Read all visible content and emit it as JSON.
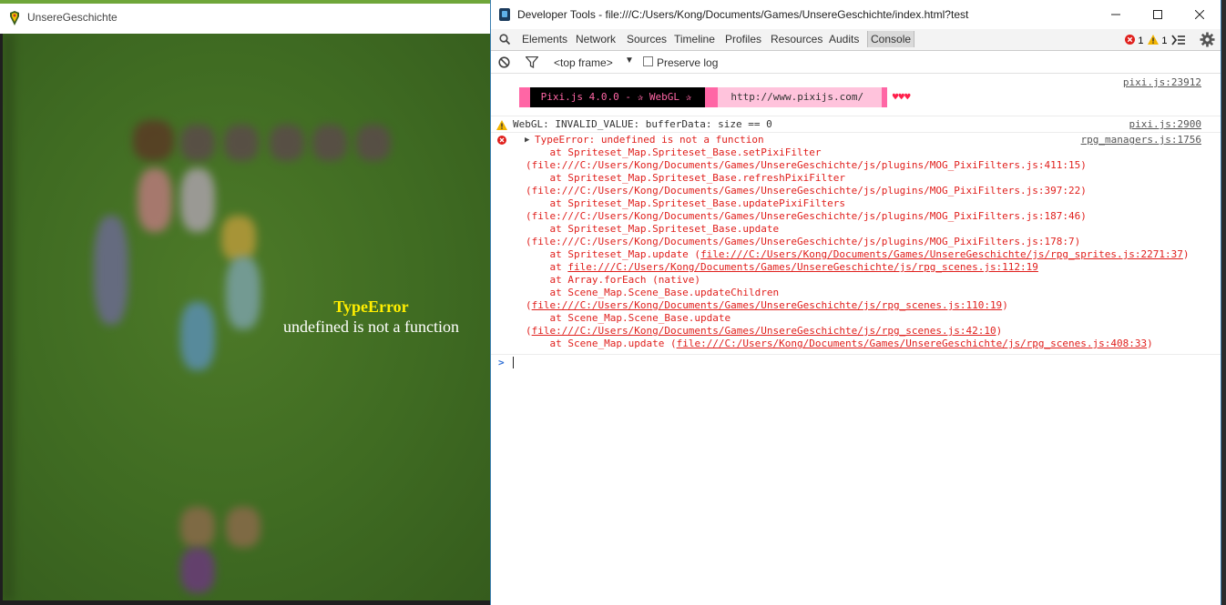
{
  "game": {
    "window_title": "UnsereGeschichte",
    "error_title": "TypeError",
    "error_message": "undefined is not a function"
  },
  "devtools": {
    "window_title": "Developer Tools - file:///C:/Users/Kong/Documents/Games/UnsereGeschichte/index.html?test",
    "tabs": [
      "Elements",
      "Network",
      "Sources",
      "Timeline",
      "Profiles",
      "Resources",
      "Audits",
      "Console"
    ],
    "active_tab": "Console",
    "error_count": "1",
    "warning_count": "1",
    "toolbar": {
      "frame_select": "<top frame>",
      "preserve_log": "Preserve log"
    },
    "console": {
      "pixi_source": "pixi.js:23912",
      "pixi_banner_text": " Pixi.js 4.0.0 - ✰ WebGL ✰ ",
      "pixi_banner_url": " http://www.pixijs.com/ ",
      "pixi_hearts": "♥♥♥",
      "warning_text": "WebGL: INVALID_VALUE: bufferData: size == 0",
      "warning_source": "pixi.js:2900",
      "error_head": "TypeError: undefined is not a function",
      "error_source": "rpg_managers.js:1756",
      "stack": [
        "    at Spriteset_Map.Spriteset_Base.setPixiFilter",
        "(file:///C:/Users/Kong/Documents/Games/UnsereGeschichte/js/plugins/MOG_PixiFilters.js:411:15)",
        "    at Spriteset_Map.Spriteset_Base.refreshPixiFilter",
        "(file:///C:/Users/Kong/Documents/Games/UnsereGeschichte/js/plugins/MOG_PixiFilters.js:397:22)",
        "    at Spriteset_Map.Spriteset_Base.updatePixiFilters",
        "(file:///C:/Users/Kong/Documents/Games/UnsereGeschichte/js/plugins/MOG_PixiFilters.js:187:46)",
        "    at Spriteset_Map.Spriteset_Base.update",
        "(file:///C:/Users/Kong/Documents/Games/UnsereGeschichte/js/plugins/MOG_PixiFilters.js:178:7)"
      ],
      "stack_linked": [
        {
          "prefix": "    at Spriteset_Map.update (",
          "link": "file:///C:/Users/Kong/Documents/Games/UnsereGeschichte/js/rpg_sprites.js:2271:37",
          "suffix": ")"
        },
        {
          "prefix": "    at ",
          "link": "file:///C:/Users/Kong/Documents/Games/UnsereGeschichte/js/rpg_scenes.js:112:19",
          "suffix": ""
        },
        {
          "prefix": "    at Array.forEach (native)",
          "link": "",
          "suffix": ""
        },
        {
          "prefix": "    at Scene_Map.Scene_Base.updateChildren",
          "link": "",
          "suffix": ""
        },
        {
          "prefix": "(",
          "link": "file:///C:/Users/Kong/Documents/Games/UnsereGeschichte/js/rpg_scenes.js:110:19",
          "suffix": ")"
        },
        {
          "prefix": "    at Scene_Map.Scene_Base.update",
          "link": "",
          "suffix": ""
        },
        {
          "prefix": "(",
          "link": "file:///C:/Users/Kong/Documents/Games/UnsereGeschichte/js/rpg_scenes.js:42:10",
          "suffix": ")"
        },
        {
          "prefix": "    at Scene_Map.update (",
          "link": "file:///C:/Users/Kong/Documents/Games/UnsereGeschichte/js/rpg_scenes.js:408:33",
          "suffix": ")"
        }
      ],
      "prompt": ">"
    }
  },
  "colors": {
    "error": "#e0201d",
    "warning": "#f2b400",
    "pixi_pink": "#ff66a5",
    "pixi_black": "#000000",
    "pixi_light": "#ffc3dc"
  }
}
